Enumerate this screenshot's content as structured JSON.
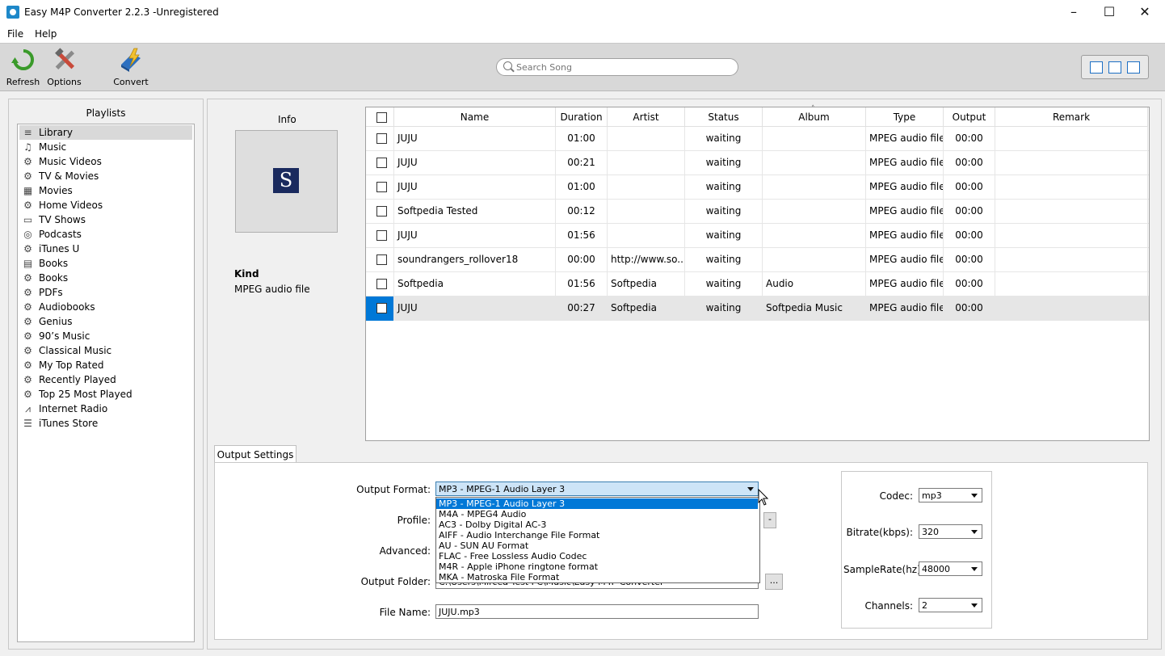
{
  "window": {
    "title": "Easy M4P Converter 2.2.3 -Unregistered"
  },
  "menu": [
    "File",
    "Help"
  ],
  "toolbar": {
    "refresh_label": "Refresh",
    "options_label": "Options",
    "convert_label": "Convert",
    "search_placeholder": "Search Song"
  },
  "playlists": {
    "title": "Playlists",
    "items": [
      {
        "label": "Library",
        "icon": "library-icon",
        "selected": true
      },
      {
        "label": "Music",
        "icon": "music-note-icon"
      },
      {
        "label": "Music Videos",
        "icon": "gear-icon"
      },
      {
        "label": "TV & Movies",
        "icon": "gear-icon"
      },
      {
        "label": "Movies",
        "icon": "film-icon"
      },
      {
        "label": "Home Videos",
        "icon": "gear-icon"
      },
      {
        "label": "TV Shows",
        "icon": "tv-icon"
      },
      {
        "label": "Podcasts",
        "icon": "podcast-icon"
      },
      {
        "label": "iTunes U",
        "icon": "gear-icon"
      },
      {
        "label": "Books",
        "icon": "book-icon"
      },
      {
        "label": "Books",
        "icon": "gear-icon"
      },
      {
        "label": "PDFs",
        "icon": "gear-icon"
      },
      {
        "label": "Audiobooks",
        "icon": "gear-icon"
      },
      {
        "label": "Genius",
        "icon": "gear-icon"
      },
      {
        "label": "90’s Music",
        "icon": "gear-icon"
      },
      {
        "label": "Classical Music",
        "icon": "gear-icon"
      },
      {
        "label": "My Top Rated",
        "icon": "gear-icon"
      },
      {
        "label": "Recently Played",
        "icon": "gear-icon"
      },
      {
        "label": "Top 25 Most Played",
        "icon": "gear-icon"
      },
      {
        "label": "Internet Radio",
        "icon": "radio-tower-icon"
      },
      {
        "label": "iTunes Store",
        "icon": "store-icon"
      }
    ]
  },
  "info": {
    "title": "Info",
    "art_letter": "S",
    "kind_label": "Kind",
    "kind_value": "MPEG audio file"
  },
  "table": {
    "columns": [
      "Name",
      "Duration",
      "Artist",
      "Status",
      "Album",
      "Type",
      "Output",
      "Remark"
    ],
    "rows": [
      {
        "name": "JUJU",
        "duration": "01:00",
        "artist": "",
        "status": "waiting",
        "album": "",
        "type": "MPEG audio file",
        "output": "00:00",
        "remark": ""
      },
      {
        "name": "JUJU",
        "duration": "00:21",
        "artist": "",
        "status": "waiting",
        "album": "",
        "type": "MPEG audio file",
        "output": "00:00",
        "remark": ""
      },
      {
        "name": "JUJU",
        "duration": "01:00",
        "artist": "",
        "status": "waiting",
        "album": "",
        "type": "MPEG audio file",
        "output": "00:00",
        "remark": ""
      },
      {
        "name": "Softpedia Tested",
        "duration": "00:12",
        "artist": "",
        "status": "waiting",
        "album": "",
        "type": "MPEG audio file",
        "output": "00:00",
        "remark": ""
      },
      {
        "name": "JUJU",
        "duration": "01:56",
        "artist": "",
        "status": "waiting",
        "album": "",
        "type": "MPEG audio file",
        "output": "00:00",
        "remark": ""
      },
      {
        "name": "soundrangers_rollover18",
        "duration": "00:00",
        "artist": "http://www.so...",
        "status": "waiting",
        "album": "",
        "type": "MPEG audio file",
        "output": "00:00",
        "remark": ""
      },
      {
        "name": "Softpedia",
        "duration": "01:56",
        "artist": "Softpedia",
        "status": "waiting",
        "album": "Audio",
        "type": "MPEG audio file",
        "output": "00:00",
        "remark": ""
      },
      {
        "name": "JUJU",
        "duration": "00:27",
        "artist": "Softpedia",
        "status": "waiting",
        "album": "Softpedia Music",
        "type": "MPEG audio file",
        "output": "00:00",
        "remark": "",
        "selected": true
      }
    ]
  },
  "output_settings": {
    "tab_label": "Output Settings",
    "output_format_label": "Output Format:",
    "output_format_value": "MP3 - MPEG-1 Audio Layer 3",
    "format_options": [
      "MP3 - MPEG-1 Audio Layer 3",
      "M4A - MPEG4 Audio",
      "AC3 - Dolby Digital AC-3",
      "AIFF - Audio Interchange File Format",
      "AU - SUN AU Format",
      "FLAC - Free Lossless Audio Codec",
      "M4R - Apple iPhone ringtone format",
      "MKA - Matroska File Format"
    ],
    "profile_label": "Profile:",
    "advanced_label": "Advanced:",
    "output_folder_label": "Output Folder:",
    "output_folder_value": "C:\\Users\\Mircea Test PC\\Music\\Easy M4P Converter",
    "browse_label": "...",
    "profile_btn_label": "-",
    "file_name_label": "File Name:",
    "file_name_value": "JUJU.mp3",
    "codec_label": "Codec:",
    "codec_value": "mp3",
    "bitrate_label": "Bitrate(kbps):",
    "bitrate_value": "320",
    "samplerate_label": "SampleRate(hz):",
    "samplerate_value": "48000",
    "channels_label": "Channels:",
    "channels_value": "2"
  }
}
